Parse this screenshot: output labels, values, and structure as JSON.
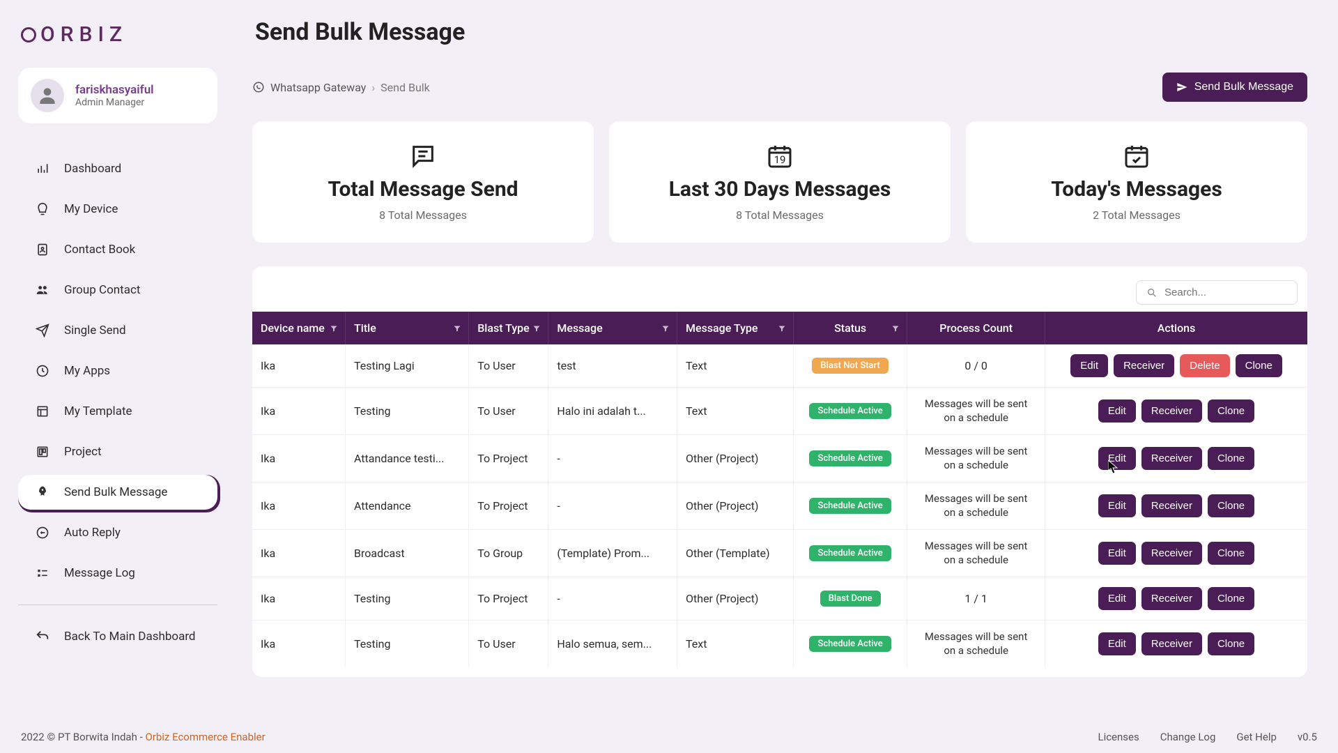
{
  "logo_text": "ORBIZ",
  "user": {
    "name": "fariskhasyaiful",
    "role": "Admin Manager"
  },
  "nav": [
    {
      "label": "Dashboard",
      "icon": "dashboard"
    },
    {
      "label": "My Device",
      "icon": "device"
    },
    {
      "label": "Contact Book",
      "icon": "contact"
    },
    {
      "label": "Group Contact",
      "icon": "group"
    },
    {
      "label": "Single Send",
      "icon": "send"
    },
    {
      "label": "My Apps",
      "icon": "apps"
    },
    {
      "label": "My Template",
      "icon": "template"
    },
    {
      "label": "Project",
      "icon": "project"
    },
    {
      "label": "Send Bulk Message",
      "icon": "rocket"
    },
    {
      "label": "Auto Reply",
      "icon": "reply"
    },
    {
      "label": "Message Log",
      "icon": "log"
    }
  ],
  "nav_back": "Back To Main Dashboard",
  "page_title": "Send Bulk Message",
  "breadcrumb": {
    "root": "Whatsapp Gateway",
    "current": "Send Bulk"
  },
  "top_button": "Send Bulk Message",
  "stats": [
    {
      "title": "Total Message Send",
      "sub": "8 Total Messages"
    },
    {
      "title": "Last 30 Days Messages",
      "sub": "8 Total Messages",
      "date": "19"
    },
    {
      "title": "Today's Messages",
      "sub": "2 Total Messages"
    }
  ],
  "search_placeholder": "Search...",
  "columns": [
    "Device name",
    "Title",
    "Blast Type",
    "Message",
    "Message Type",
    "Status",
    "Process Count",
    "Actions"
  ],
  "status_labels": {
    "not_start": "Blast Not Start",
    "active": "Schedule Active",
    "done": "Blast Done"
  },
  "process_scheduled": "Messages will be sent on a schedule",
  "action_labels": {
    "edit": "Edit",
    "receiver": "Receiver",
    "delete": "Delete",
    "clone": "Clone"
  },
  "rows": [
    {
      "device": "Ika",
      "title": "Testing Lagi",
      "blast": "To User",
      "message": "test",
      "mtype": "Text",
      "status": "not_start",
      "process": "0 / 0",
      "actions": [
        "edit",
        "receiver",
        "delete",
        "clone"
      ]
    },
    {
      "device": "Ika",
      "title": "Testing",
      "blast": "To User",
      "message": "Halo ini adalah t...",
      "mtype": "Text",
      "status": "active",
      "process": "scheduled",
      "actions": [
        "edit",
        "receiver",
        "clone"
      ]
    },
    {
      "device": "Ika",
      "title": "Attandance testi...",
      "blast": "To Project",
      "message": "-",
      "mtype": "Other (Project)",
      "status": "active",
      "process": "scheduled",
      "actions": [
        "edit",
        "receiver",
        "clone"
      ]
    },
    {
      "device": "Ika",
      "title": "Attendance",
      "blast": "To Project",
      "message": "-",
      "mtype": "Other (Project)",
      "status": "active",
      "process": "scheduled",
      "actions": [
        "edit",
        "receiver",
        "clone"
      ]
    },
    {
      "device": "Ika",
      "title": "Broadcast",
      "blast": "To Group",
      "message": "(Template) Prom...",
      "mtype": "Other (Template)",
      "status": "active",
      "process": "scheduled",
      "actions": [
        "edit",
        "receiver",
        "clone"
      ]
    },
    {
      "device": "Ika",
      "title": "Testing",
      "blast": "To Project",
      "message": "-",
      "mtype": "Other (Project)",
      "status": "done",
      "process": "1 / 1",
      "actions": [
        "edit",
        "receiver",
        "clone"
      ]
    },
    {
      "device": "Ika",
      "title": "Testing",
      "blast": "To User",
      "message": "Halo semua, sem...",
      "mtype": "Text",
      "status": "active",
      "process": "scheduled",
      "actions": [
        "edit",
        "receiver",
        "clone"
      ]
    }
  ],
  "footer": {
    "copy": "2022 © PT Borwita Indah - ",
    "brand": "Orbiz Ecommerce Enabler",
    "links": [
      "Licenses",
      "Change Log",
      "Get Help"
    ],
    "version": "v0.5"
  }
}
